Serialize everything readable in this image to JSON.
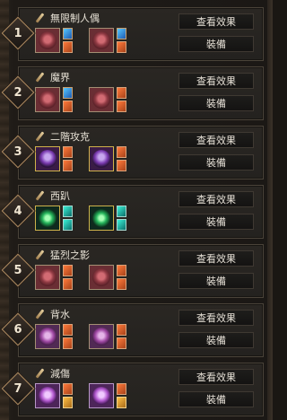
{
  "colors": {
    "accent_gold": "#b08d62",
    "panel_bg": "#24221f"
  },
  "buttons": {
    "view_effect": "查看效果",
    "equip": "裝備"
  },
  "presets": [
    {
      "number": "1",
      "name": "無限制人偶",
      "items": [
        {
          "type": "red",
          "cards": [
            "blue",
            "red"
          ]
        },
        {
          "type": "red",
          "cards": [
            "blue",
            "red"
          ]
        }
      ]
    },
    {
      "number": "2",
      "name": "魔界",
      "items": [
        {
          "type": "red",
          "cards": [
            "blue",
            "red"
          ]
        },
        {
          "type": "red",
          "cards": [
            "red",
            "red"
          ]
        }
      ]
    },
    {
      "number": "3",
      "name": "二階攻克",
      "items": [
        {
          "type": "purple",
          "cards": [
            "red",
            "red"
          ]
        },
        {
          "type": "purple",
          "cards": [
            "red",
            "red"
          ]
        }
      ]
    },
    {
      "number": "4",
      "name": "西趴",
      "items": [
        {
          "type": "green",
          "cards": [
            "teal",
            "teal"
          ]
        },
        {
          "type": "green",
          "cards": [
            "teal",
            "teal"
          ]
        }
      ]
    },
    {
      "number": "5",
      "name": "猛烈之影",
      "items": [
        {
          "type": "red",
          "cards": [
            "red",
            "red"
          ]
        },
        {
          "type": "red",
          "cards": [
            "red",
            "red"
          ]
        }
      ]
    },
    {
      "number": "6",
      "name": "背水",
      "items": [
        {
          "type": "pink",
          "cards": [
            "red",
            "red"
          ]
        },
        {
          "type": "pink",
          "cards": [
            "red",
            "red"
          ]
        }
      ]
    },
    {
      "number": "7",
      "name": "減傷",
      "items": [
        {
          "type": "violet",
          "cards": [
            "red",
            "gold"
          ]
        },
        {
          "type": "violet",
          "cards": [
            "red",
            "gold"
          ]
        }
      ]
    }
  ]
}
